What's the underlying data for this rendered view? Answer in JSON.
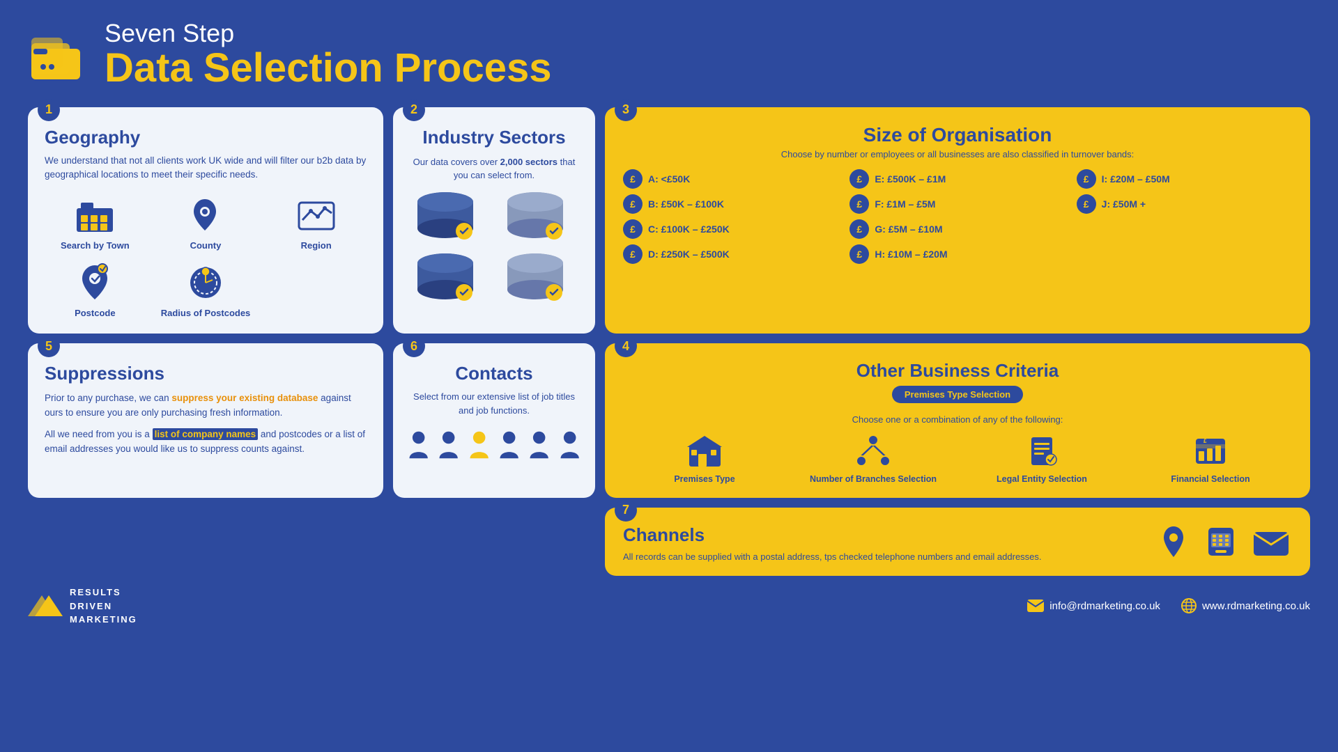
{
  "header": {
    "subtitle": "Seven Step",
    "title": "Data Selection Process"
  },
  "step1": {
    "number": "1",
    "heading": "Geography",
    "body": "We understand that not all clients work UK wide and will filter our b2b data by geographical locations to meet their specific needs.",
    "icons": [
      {
        "label": "Search by Town",
        "icon": "building"
      },
      {
        "label": "County",
        "icon": "map-pin"
      },
      {
        "label": "Region",
        "icon": "map"
      },
      {
        "label": "Postcode",
        "icon": "map-search"
      },
      {
        "label": "Radius of Postcodes",
        "icon": "radius"
      }
    ]
  },
  "step2": {
    "number": "2",
    "heading": "Industry Sectors",
    "body": "Our data covers over 2,000 sectors that you can select from."
  },
  "step3": {
    "number": "3",
    "heading": "Size of Organisation",
    "subtitle": "Choose by number or employees or all businesses are also classified in turnover bands:",
    "bands": [
      "A: <£50K",
      "E: £500K – £1M",
      "I: £20M – £50M",
      "B: £50K – £100K",
      "F: £1M – £5M",
      "J: £50M +",
      "C: £100K – £250K",
      "G: £5M – £10M",
      "",
      "D: £250K – £500K",
      "H: £10M – £20M",
      ""
    ]
  },
  "step4": {
    "number": "4",
    "heading": "Other Business Criteria",
    "badge": "Premises Type Selection",
    "subtitle": "Choose one or a combination of any of the following:",
    "criteria": [
      {
        "label": "Premises Type",
        "icon": "building2"
      },
      {
        "label": "Number of Branches Selection",
        "icon": "branches"
      },
      {
        "label": "Legal Entity Selection",
        "icon": "legal"
      },
      {
        "label": "Financial Selection",
        "icon": "financial"
      }
    ]
  },
  "step5": {
    "number": "5",
    "heading": "Suppressions",
    "para1": "Prior to any purchase, we can suppress your existing database against ours to ensure you are only purchasing fresh information.",
    "para1_highlight": "suppress your existing database",
    "para2_pre": "All we need from you is a ",
    "para2_highlight": "list of company names",
    "para2_post": " and postcodes or a list of email addresses you would like us to suppress counts against."
  },
  "step6": {
    "number": "6",
    "heading": "Contacts",
    "body": "Select from our extensive list of job titles and job functions."
  },
  "step7": {
    "number": "7",
    "heading": "Channels",
    "body": "All records can be supplied with a postal address, tps checked telephone numbers and email addresses."
  },
  "footer": {
    "company_lines": [
      "RESULTS",
      "DRIVEN",
      "MARKETING"
    ],
    "email": "info@rdmarketing.co.uk",
    "website": "www.rdmarketing.co.uk"
  }
}
